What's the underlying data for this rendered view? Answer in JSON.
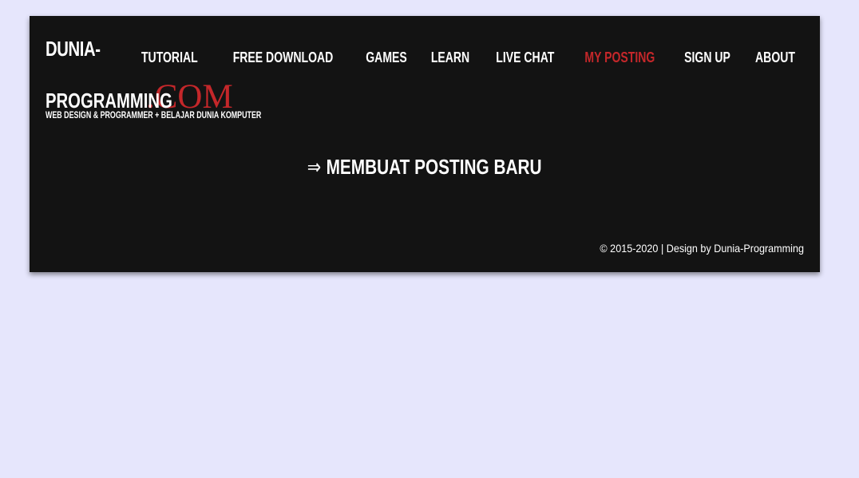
{
  "site": {
    "logo_line1": "DUNIA-",
    "logo_line2": "PROGRAMMING",
    "logo_suffix": ".COM",
    "tagline": "WEB DESIGN & PROGRAMMER + BELAJAR DUNIA KOMPUTER"
  },
  "nav": {
    "items": [
      {
        "label": "TUTORIAL"
      },
      {
        "label": "FREE DOWNLOAD"
      },
      {
        "label": "GAMES"
      },
      {
        "label": "LEARN"
      },
      {
        "label": "LIVE CHAT"
      },
      {
        "label": "MY POSTING"
      },
      {
        "label": "SIGN UP"
      },
      {
        "label": "ABOUT"
      }
    ],
    "active": "MY POSTING"
  },
  "main": {
    "arrow": "⇒",
    "heading": "MEMBUAT POSTING BARU"
  },
  "footer": {
    "text": "© 2015-2020 | Design by Dunia-Programming"
  },
  "colors": {
    "page_bg": "#e6e6fc",
    "panel_bg": "#131313",
    "accent": "#c4272a",
    "text": "#ffffff"
  }
}
